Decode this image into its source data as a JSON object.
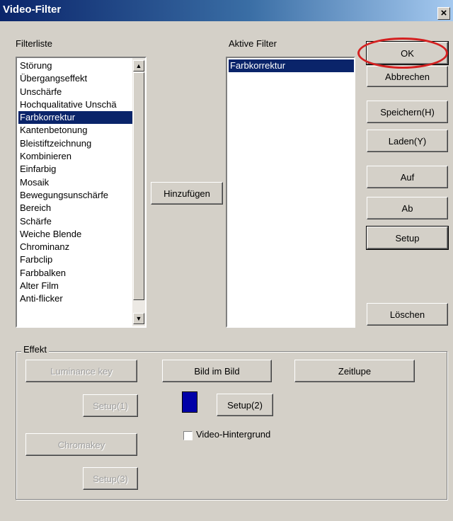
{
  "window": {
    "title": "Video-Filter",
    "close_glyph": "×"
  },
  "filterliste": {
    "label": "Filterliste",
    "items": [
      "Störung",
      "Übergangseffekt",
      "Unschärfe",
      "Hochqualitative Unschä",
      "Farbkorrektur",
      "Kantenbetonung",
      "Bleistiftzeichnung",
      "Kombinieren",
      "Einfarbig",
      "Mosaik",
      "Bewegungsunschärfe",
      "Bereich",
      "Schärfe",
      "Weiche Blende",
      "Chrominanz",
      "Farbclip",
      "Farbbalken",
      "Alter Film",
      "Anti-flicker"
    ],
    "selected_index": 4
  },
  "add_button": "Hinzufügen",
  "aktive_filter": {
    "label": "Aktive Filter",
    "items": [
      "Farbkorrektur"
    ],
    "selected_index": 0
  },
  "buttons": {
    "ok": "OK",
    "cancel": "Abbrechen",
    "save": "Speichern(H)",
    "load": "Laden(Y)",
    "up": "Auf",
    "down": "Ab",
    "setup": "Setup",
    "delete": "Löschen"
  },
  "effekt": {
    "label": "Effekt",
    "luminance_key": "Luminance key",
    "bild_im_bild": "Bild im Bild",
    "zeitlupe": "Zeitlupe",
    "setup1": "Setup(1)",
    "setup2": "Setup(2)",
    "chromakey": "Chromakey",
    "setup3": "Setup(3)",
    "video_hintergrund": "Video-Hintergrund",
    "color_swatch": "#0000a8"
  },
  "icons": {
    "scroll_up": "▲",
    "scroll_down": "▼"
  },
  "colors": {
    "title_bar": "#0a246a",
    "selection": "#0a246a",
    "highlight_ring": "#d42020"
  }
}
